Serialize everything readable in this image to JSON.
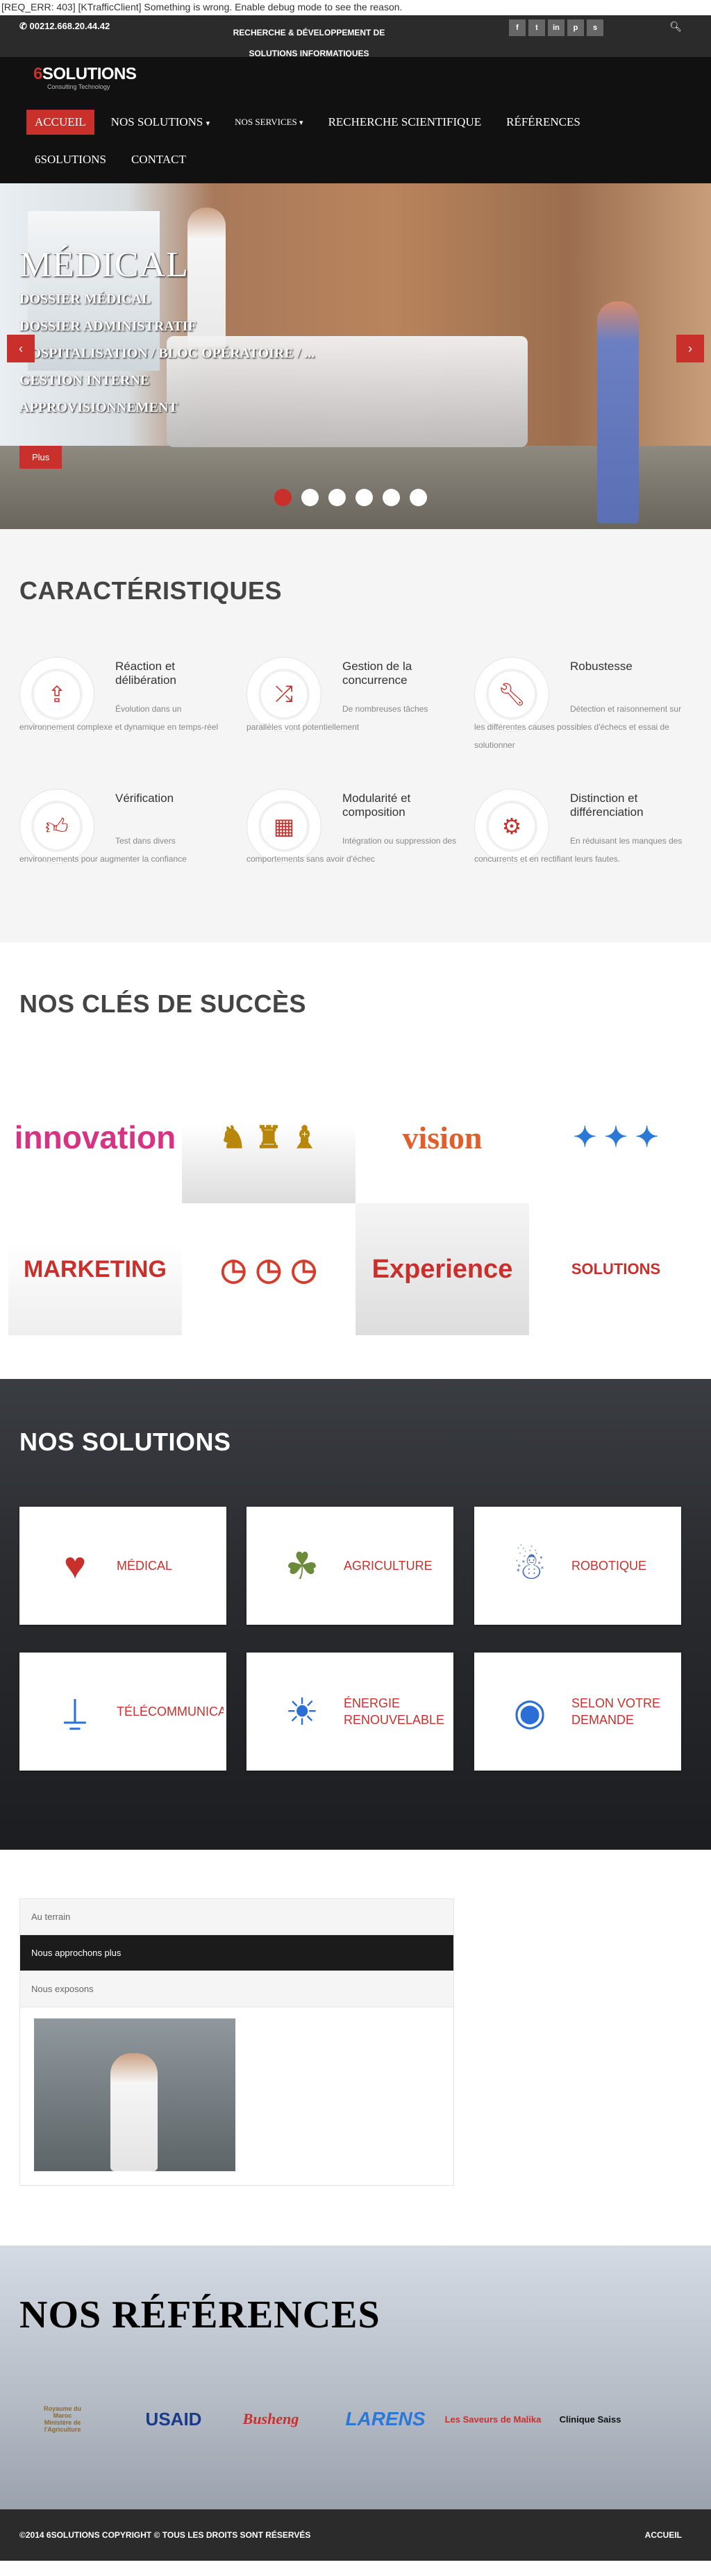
{
  "error_line": "[REQ_ERR: 403] [KTrafficClient] Something is wrong. Enable debug mode to see the reason.",
  "topbar": {
    "phone": "00212.668.20.44.42",
    "tagline": "RECHERCHE & DÉVELOPPEMENT DE SOLUTIONS INFORMATIQUES",
    "socials": [
      "f",
      "t",
      "in",
      "p",
      "s"
    ]
  },
  "logo": {
    "brand_a": "6",
    "brand_b": "SOLUTIONS",
    "sub": "Consulting Technology"
  },
  "nav": {
    "accueil": "ACCUEIL",
    "solutions": "NOS SOLUTIONS",
    "services": "NOS SERVICES",
    "recherche": "RECHERCHE SCIENTIFIQUE",
    "references": "RÉFÉRENCES",
    "about": "6SOLUTIONS",
    "contact": "CONTACT"
  },
  "hero": {
    "title": "MÉDICAL",
    "items": [
      "DOSSIER MÉDICAL",
      "DOSSIER ADMINISTRATIF",
      "HOSPITALISATION / BLOC OPÉRATOIRE / ...",
      "GESTION INTERNE",
      "APPROVISIONNEMENT"
    ],
    "button": "Plus",
    "prev": "‹",
    "next": "›"
  },
  "features": {
    "title": "CARACTÉRISTIQUES",
    "items": [
      {
        "title": "Réaction et délibération",
        "text": "Évolution dans un environnement complexe et dynamique en temps-réel",
        "icon": "upload-icon"
      },
      {
        "title": "Gestion de la concurrence",
        "text": "De nombreuses tâches parallèles vont potentiellement",
        "icon": "shuffle-icon"
      },
      {
        "title": "Robustesse",
        "text": "Détection et raisonnement sur les différentes causes possibles d'échecs et essai de solutionner",
        "icon": "wrench-icon"
      },
      {
        "title": "Vérification",
        "text": "Test dans divers environnements pour augmenter la confiance",
        "icon": "thumbs-up-icon"
      },
      {
        "title": "Modularité et composition",
        "text": "Intégration ou suppression des comportements sans avoir d'échec",
        "icon": "grid-icon"
      },
      {
        "title": "Distinction et différenciation",
        "text": "En réduisant les manques des concurrents et en rectifiant leurs fautes.",
        "icon": "gears-icon"
      }
    ]
  },
  "keys": {
    "title": "NOS CLÉS DE SUCCÈS",
    "tiles": [
      {
        "label": "innovation"
      },
      {
        "label": "♞ ♜ ♝"
      },
      {
        "label": "vision"
      },
      {
        "label": "✦ ✦ ✦"
      },
      {
        "label": "MARKETING"
      },
      {
        "label": "◷ ◷ ◷"
      },
      {
        "label": "Experience"
      },
      {
        "label": "SOLUTIONS"
      }
    ]
  },
  "solutions": {
    "title": "NOS SOLUTIONS",
    "cards": [
      {
        "label": "MÉDICAL",
        "icon": "medical-heart-icon"
      },
      {
        "label": "AGRICULTURE",
        "icon": "farmer-icon"
      },
      {
        "label": "ROBOTIQUE",
        "icon": "robot-icon"
      },
      {
        "label": "TÉLÉCOMMUNICATIONS",
        "icon": "antenna-icon"
      },
      {
        "label": "ÉNERGIE RENOUVELABLE",
        "icon": "solar-panel-icon"
      },
      {
        "label": "SELON VOTRE DEMANDE",
        "icon": "cd-box-icon"
      }
    ]
  },
  "accordion": {
    "items": [
      "Au terrain",
      "Nous approchons plus",
      "Nous exposons"
    ]
  },
  "references": {
    "title": "NOS RÉFÉRENCES",
    "logos": [
      {
        "name": "Royaume du Maroc\nMinistère de l'Agriculture"
      },
      {
        "name": "USAID"
      },
      {
        "name": "Busheng"
      },
      {
        "name": "LARENS"
      },
      {
        "name": "Les Saveurs de Malika"
      },
      {
        "name": "Clinique Saiss"
      }
    ]
  },
  "footer": {
    "prefix": "©2014",
    "brand": "6SOLUTIONS",
    "rights": "COPYRIGHT © TOUS LES DROITS SONT RÉSERVÉS",
    "home": "ACCUEIL"
  },
  "colors": {
    "accent": "#c9302c",
    "dark": "#111111",
    "topbar": "#2b2b2b"
  }
}
